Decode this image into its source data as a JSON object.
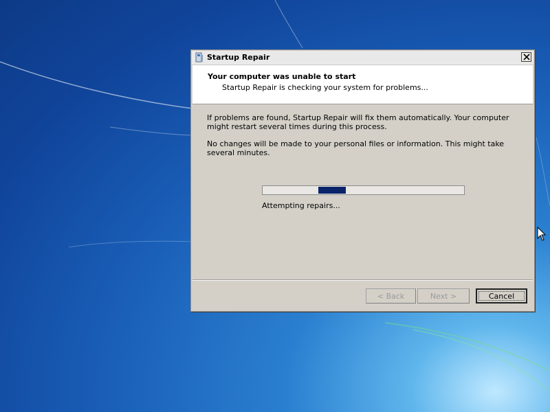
{
  "window": {
    "title": "Startup Repair"
  },
  "header": {
    "title": "Your computer was unable to start",
    "subtitle": "Startup Repair is checking your system for problems..."
  },
  "body": {
    "paragraph1": "If problems are found, Startup Repair will fix them automatically. Your computer might restart several times during this process.",
    "paragraph2": "No changes will be made to your personal files or information. This might take several minutes."
  },
  "progress": {
    "style": "marquee",
    "status": "Attempting repairs...",
    "fill_color": "#0a246a"
  },
  "buttons": {
    "back": "< Back",
    "next": "Next >",
    "cancel": "Cancel"
  },
  "icons": {
    "title_icon": "startup-repair-icon",
    "close": "close-icon",
    "cursor": "mouse-pointer-icon"
  }
}
